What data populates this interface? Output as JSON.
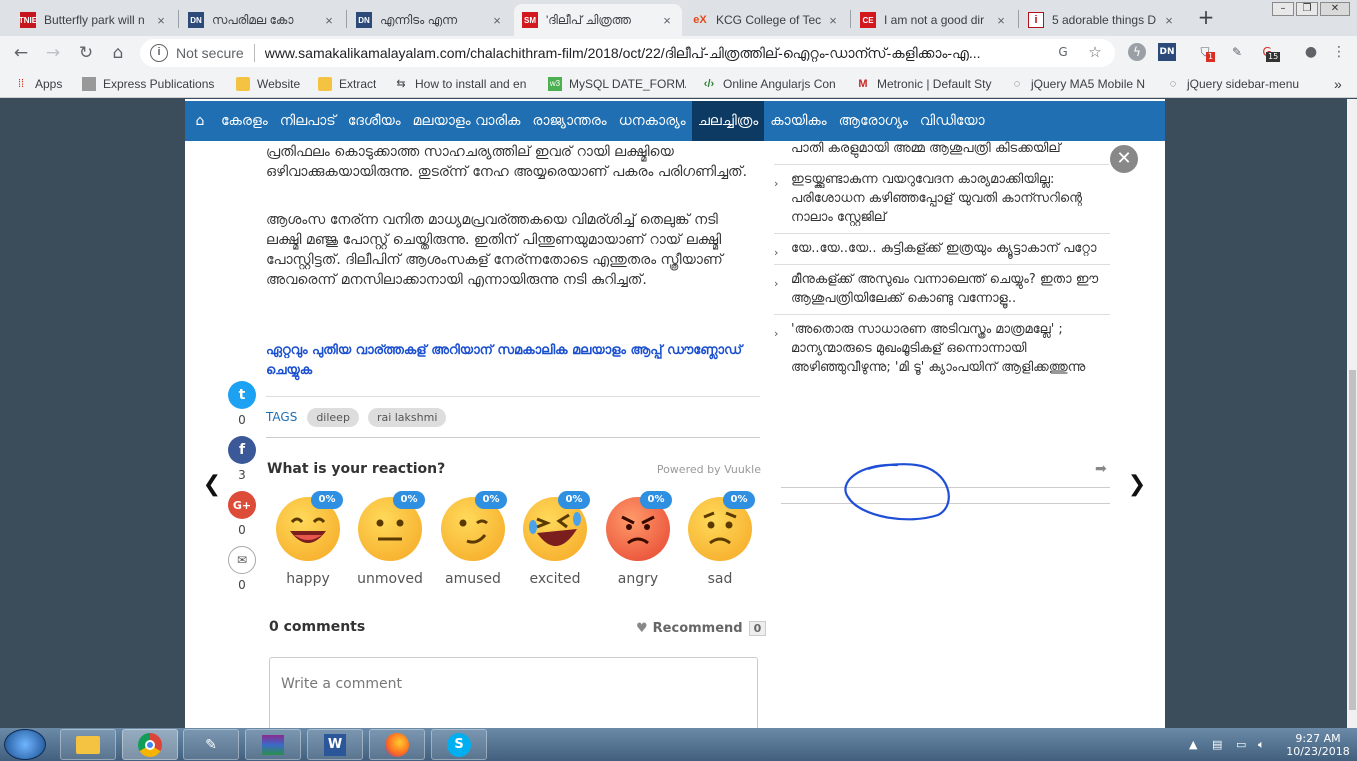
{
  "browser": {
    "tabs": [
      {
        "title": "Butterfly park will n",
        "favicon_text": "TNIE",
        "favicon_color": "#c4161c"
      },
      {
        "title": "സപരിമല കോ",
        "favicon_text": "DN",
        "favicon_color": "#2b4a7a"
      },
      {
        "title": "എന്നിടം എന്ന",
        "favicon_text": "DN",
        "favicon_color": "#2b4a7a"
      },
      {
        "title": "'ദിലീപ് ചിത്രത്ത",
        "favicon_text": "SM",
        "favicon_color": "#d31920",
        "active": true
      },
      {
        "title": "KCG College of Tec",
        "favicon_text": "eX",
        "favicon_color": "#e04a1a"
      },
      {
        "title": "I am not a good dir",
        "favicon_text": "CE",
        "favicon_color": "#d3171e"
      },
      {
        "title": "5 adorable things D",
        "favicon_text": "i",
        "favicon_color": "#b3121b"
      }
    ],
    "close_glyph": "×",
    "new_tab_glyph": "+",
    "security_label": "Not secure",
    "url": "www.samakalikamalayalam.com/chalachithram-film/2018/oct/22/ദിലീപ്-ചിത്രത്തില്-ഐറ്റം-ഡാന്സ്-കളിക്കാം-എ...",
    "ext_badge_1": "1",
    "ext_badge_2": "15"
  },
  "bookmarks": [
    {
      "label": "Apps",
      "icon": "apps-icon"
    },
    {
      "label": "Express Publications (",
      "icon": "page-icon"
    },
    {
      "label": "Website",
      "icon": "folder-icon"
    },
    {
      "label": "Extract",
      "icon": "folder-icon"
    },
    {
      "label": "How to install and en",
      "icon": "link-icon"
    },
    {
      "label": "MySQL DATE_FORMA",
      "icon": "w3-icon"
    },
    {
      "label": "Online Angularjs Con",
      "icon": "code-icon"
    },
    {
      "label": "Metronic | Default Sty",
      "icon": "metronic-icon"
    },
    {
      "label": "jQuery MA5 Mobile N",
      "icon": "jquery-icon"
    },
    {
      "label": "jQuery sidebar-menu",
      "icon": "jquery-icon"
    }
  ],
  "nav": {
    "home_glyph": "⌂",
    "items": [
      "കേരളം",
      "നിലപാട്",
      "ദേശീയം",
      "മലയാളം വാരിക",
      "രാജ്യാന്തരം",
      "ധനകാര്യം",
      "ചലച്ചിത്രം",
      "കായികം",
      "ആരോഗ്യം",
      "വിഡിയോ"
    ],
    "active_index": 6
  },
  "article": {
    "para1": "പ്രതിഫലം കൊടുക്കാത്ത സാഹചര്യത്തില് ഇവര് റായി ലക്ഷ്മിയെ ഒഴിവാക്കുകയായിരുന്നു. തുടര്ന്ന് നേഹ അയ്യരെയാണ് പകരം പരിഗണിച്ചത്.",
    "para2": "ആശംസ നേര്ന്ന വനിത മാധ്യമപ്രവര്ത്തകയെ വിമര്ശിച്ച് തെലുങ്ക് നടി ലക്ഷ്മി മഞ്ജു പോസ്റ്റ് ചെയ്തിരുന്നു. ഇതിന് പിന്തുണയുമായാണ് റായ് ലക്ഷ്മി പോസ്റ്റിട്ടത്. ദിലീപിന് ആശംസകള് നേര്ന്നതോടെ എന്തുതരം സ്ത്രീയാണ് അവരെന്ന് മനസിലാക്കാനായി എന്നായിരുന്നു നടി കുറിച്ചത്.",
    "promo": "ഏറ്റവും പുതിയ വാര്ത്തകള് അറിയാന് സമകാലിക മലയാളം ആപ്പ് ഡൗണ്ലോഡ് ചെയ്യുക",
    "tags_label": "TAGS",
    "tags": [
      "dileep",
      "rai lakshmi"
    ]
  },
  "share": [
    {
      "icon": "twitter-icon",
      "count": "0",
      "color": "#1da1f2"
    },
    {
      "icon": "facebook-icon",
      "count": "3",
      "color": "#3b5998"
    },
    {
      "icon": "google-plus-icon",
      "count": "0",
      "color": "#dd4b39"
    },
    {
      "icon": "email-icon",
      "count": "0",
      "color": "#ffffff"
    }
  ],
  "reactions": {
    "heading": "What is your reaction?",
    "powered_by": "Powered by Vuukle",
    "items": [
      {
        "label": "happy",
        "percent": "0%"
      },
      {
        "label": "unmoved",
        "percent": "0%"
      },
      {
        "label": "amused",
        "percent": "0%"
      },
      {
        "label": "excited",
        "percent": "0%"
      },
      {
        "label": "angry",
        "percent": "0%"
      },
      {
        "label": "sad",
        "percent": "0%"
      }
    ]
  },
  "comments": {
    "count_label": "0 comments",
    "recommend_label": "Recommend",
    "recommend_count": "0",
    "placeholder": "Write a comment"
  },
  "sidebar": {
    "items": [
      "പാതി കരളുമായി അമ്മ ആശുപത്രി കിടക്കയില്",
      "ഇടയ്ക്കുണ്ടാകുന്ന വയറുവേദന കാര്യമാക്കിയില്ല: പരിശോധന കഴിഞ്ഞപ്പോള് യുവതി കാന്സറിന്റെ നാലാം സ്റ്റേജില്",
      "യേ..യേ..യേ.. കുട്ടികള്ക്ക് ഇത്രയും ക്യൂട്ടാകാന് പറ്റോ",
      "മീനുകള്ക്ക് അസുഖം വന്നാലെന്ത് ചെയ്യും? ഇതാ  ഈ ആശുപത്രിയിലേക്ക് കൊണ്ടു വന്നോളൂ..",
      "'അതൊരു സാധാരണ അടിവസ്ത്രം മാത്രമല്ലേ' ; മാന്യന്മാരുടെ മുഖംമൂടികള് ഒന്നൊന്നായി അഴിഞ്ഞുവീഴുന്നു; 'മി ടൂ' ക്യാംപയിന് ആളിക്കത്തുന്നു"
    ],
    "close_glyph": "✕",
    "prev_glyph": "❮",
    "next_glyph": "❯"
  },
  "taskbar": {
    "time": "9:27 AM",
    "date": "10/23/2018"
  }
}
